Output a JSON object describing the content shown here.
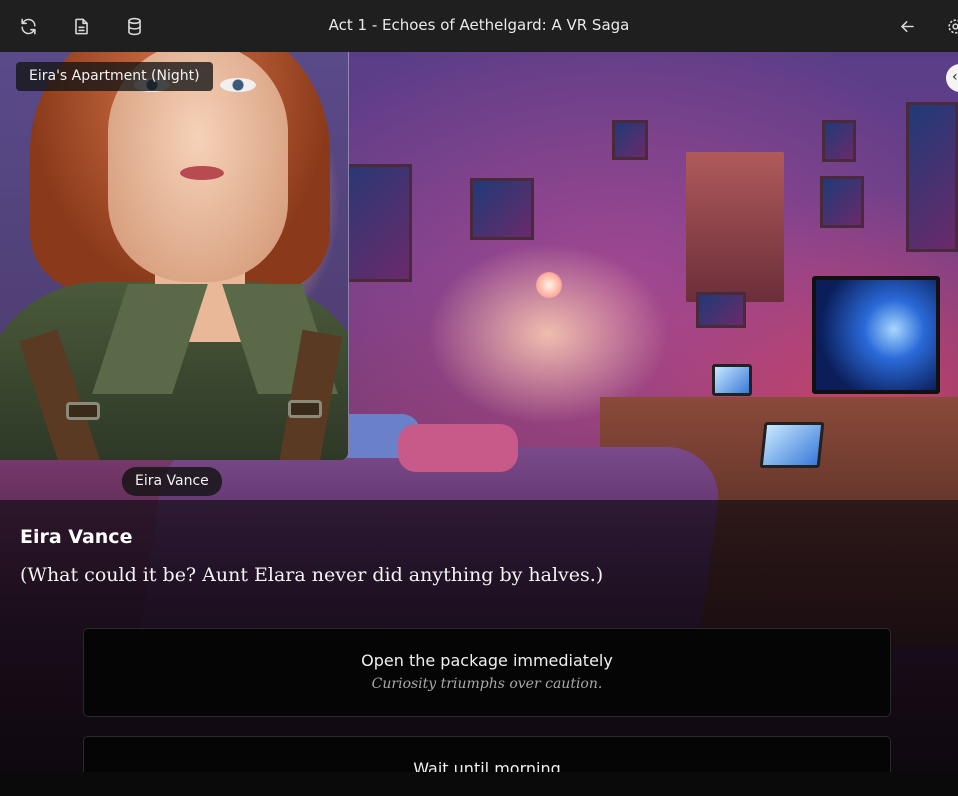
{
  "header": {
    "title": "Act 1 - Echoes of Aethelgard: A VR Saga",
    "left_icons": [
      "refresh-icon",
      "document-icon",
      "database-icon"
    ],
    "right_icons": [
      "arrow-left-icon",
      "gear-icon"
    ]
  },
  "scene": {
    "location": "Eira's Apartment (Night)",
    "character_name": "Eira Vance"
  },
  "dialogue": {
    "speaker": "Eira Vance",
    "text": "(What could it be? Aunt Elara never did anything by halves.)"
  },
  "choices": [
    {
      "label": "Open the package immediately",
      "hint": "Curiosity triumphs over caution."
    },
    {
      "label": "Wait until morning",
      "hint": ""
    }
  ],
  "colors": {
    "topbar": "#1f1f1f",
    "choice_bg": "#050505",
    "hint_text": "#a8a8a8"
  }
}
